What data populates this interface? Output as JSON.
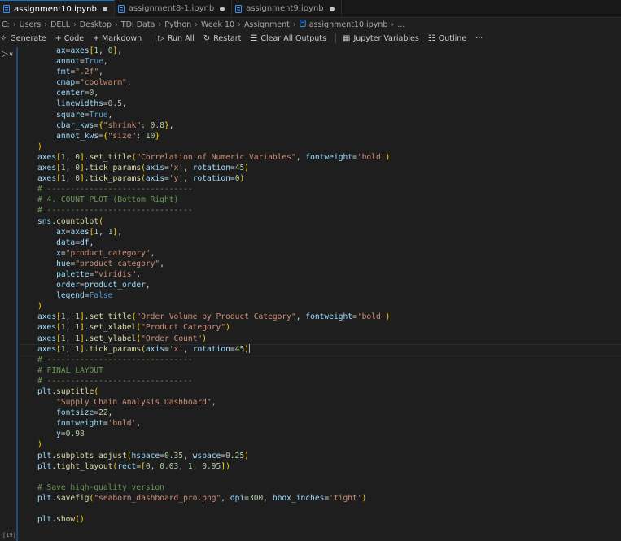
{
  "tabs": [
    {
      "label": "assignment10.ipynb",
      "active": true
    },
    {
      "label": "assignment8-1.ipynb",
      "active": false
    },
    {
      "label": "assignment9.ipynb",
      "active": false
    }
  ],
  "breadcrumbs": [
    "C:",
    "Users",
    "DELL",
    "Desktop",
    "TDI Data",
    "Python",
    "Week 10",
    "Assignment",
    "assignment10.ipynb",
    "..."
  ],
  "toolbar": {
    "generate": "Generate",
    "code": "+ Code",
    "markdown": "+ Markdown",
    "run_all": "Run All",
    "restart": "Restart",
    "clear_all": "Clear All Outputs",
    "variables": "Jupyter Variables",
    "outline": "Outline",
    "more": "···"
  },
  "cell": {
    "exec_count": "[19]",
    "lines": [
      "    ax=axes[1, 0],",
      "    annot=True,",
      "    fmt=\".2f\",",
      "    cmap=\"coolwarm\",",
      "    center=0,",
      "    linewidths=0.5,",
      "    square=True,",
      "    cbar_kws={\"shrink\": 0.8},",
      "    annot_kws={\"size\": 10}",
      ")",
      "axes[1, 0].set_title(\"Correlation of Numeric Variables\", fontweight='bold')",
      "axes[1, 0].tick_params(axis='x', rotation=45)",
      "axes[1, 0].tick_params(axis='y', rotation=0)",
      "# -------------------------------",
      "# 4. COUNT PLOT (Bottom Right)",
      "# -------------------------------",
      "sns.countplot(",
      "    ax=axes[1, 1],",
      "    data=df,",
      "    x=\"product_category\",",
      "    hue=\"product_category\",",
      "    palette=\"viridis\",",
      "    order=product_order,",
      "    legend=False",
      ")",
      "axes[1, 1].set_title(\"Order Volume by Product Category\", fontweight='bold')",
      "axes[1, 1].set_xlabel(\"Product Category\")",
      "axes[1, 1].set_ylabel(\"Order Count\")",
      "axes[1, 1].tick_params(axis='x', rotation=45)",
      "# -------------------------------",
      "# FINAL LAYOUT",
      "# -------------------------------",
      "plt.suptitle(",
      "    \"Supply Chain Analysis Dashboard\",",
      "    fontsize=22,",
      "    fontweight='bold',",
      "    y=0.98",
      ")",
      "plt.subplots_adjust(hspace=0.35, wspace=0.25)",
      "plt.tight_layout(rect=[0, 0.03, 1, 0.95])",
      "",
      "# Save high-quality version",
      "plt.savefig(\"seaborn_dashboard_pro.png\", dpi=300, bbox_inches='tight')",
      "",
      "plt.show()"
    ]
  }
}
